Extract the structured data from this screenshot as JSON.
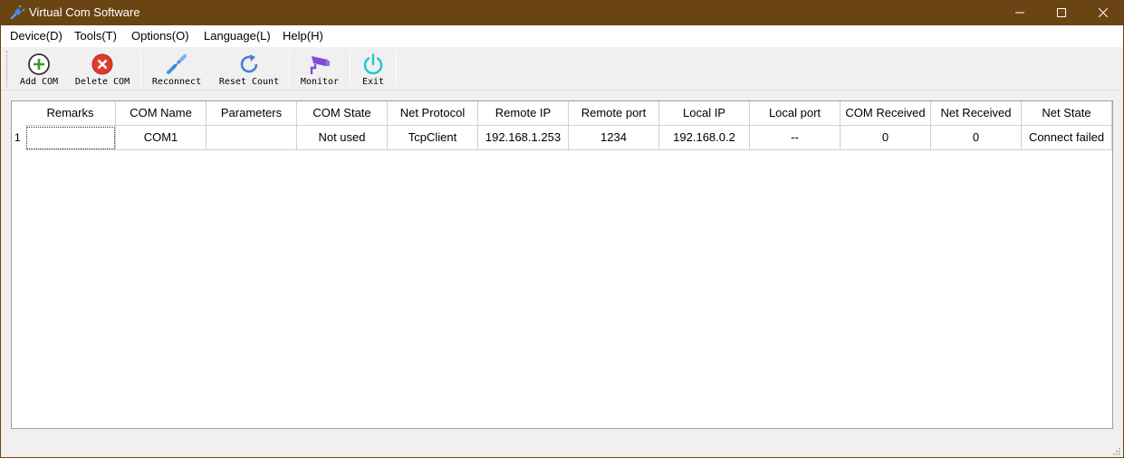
{
  "window": {
    "title": "Virtual Com Software",
    "icons": {
      "app": "usb-plug-icon",
      "minimize": "minimize-icon",
      "maximize": "maximize-icon",
      "close": "close-icon"
    }
  },
  "menu": {
    "items": [
      {
        "label": "Device(D)"
      },
      {
        "label": "Tools(T)"
      },
      {
        "label": "Options(O)"
      },
      {
        "label": "Language(L)"
      },
      {
        "label": "Help(H)"
      }
    ]
  },
  "toolbar": {
    "buttons": [
      {
        "label": "Add COM",
        "icon": "add-circle-icon",
        "color": "#3a9a2a"
      },
      {
        "label": "Delete COM",
        "icon": "delete-circle-icon",
        "color": "#e03a2f"
      },
      {
        "label": "Reconnect",
        "icon": "link-icon",
        "color": "#4a90e2"
      },
      {
        "label": "Reset Count",
        "icon": "refresh-icon",
        "color": "#4a7fd4"
      },
      {
        "label": "Monitor",
        "icon": "camera-icon",
        "color": "#7b4fd8"
      },
      {
        "label": "Exit",
        "icon": "power-icon",
        "color": "#1ec8c8"
      }
    ]
  },
  "table": {
    "columns": [
      "Remarks",
      "COM Name",
      "Parameters",
      "COM State",
      "Net Protocol",
      "Remote IP",
      "Remote port",
      "Local IP",
      "Local port",
      "COM Received",
      "Net Received",
      "Net State"
    ],
    "rows": [
      {
        "index": "1",
        "cells": [
          "",
          "COM1",
          "",
          "Not used",
          "TcpClient",
          "192.168.1.253",
          "1234",
          "192.168.0.2",
          "--",
          "0",
          "0",
          "Connect failed"
        ]
      }
    ]
  },
  "colors": {
    "titlebar": "#6b4413",
    "border": "#a0a0a0"
  }
}
